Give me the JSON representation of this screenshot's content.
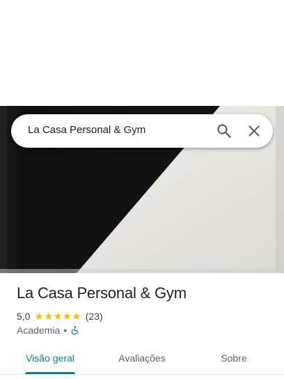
{
  "search": {
    "query": "La Casa Personal & Gym",
    "search_icon": "search-icon",
    "close_icon": "close-icon"
  },
  "place": {
    "name": "La Casa Personal & Gym",
    "rating": "5,0",
    "stars": "★★★★★",
    "review_count": "(23)",
    "category": "Academia",
    "separator": "•",
    "accessibility_icon": "wheelchair-accessible-icon"
  },
  "tabs": [
    {
      "label": "Visão geral",
      "active": true
    },
    {
      "label": "Avaliações",
      "active": false
    },
    {
      "label": "Sobre",
      "active": false
    }
  ],
  "colors": {
    "accent": "#0f7f87",
    "star": "#fbbc04",
    "accessible": "#1a73e8",
    "text": "#202124",
    "muted": "#5f6368"
  }
}
